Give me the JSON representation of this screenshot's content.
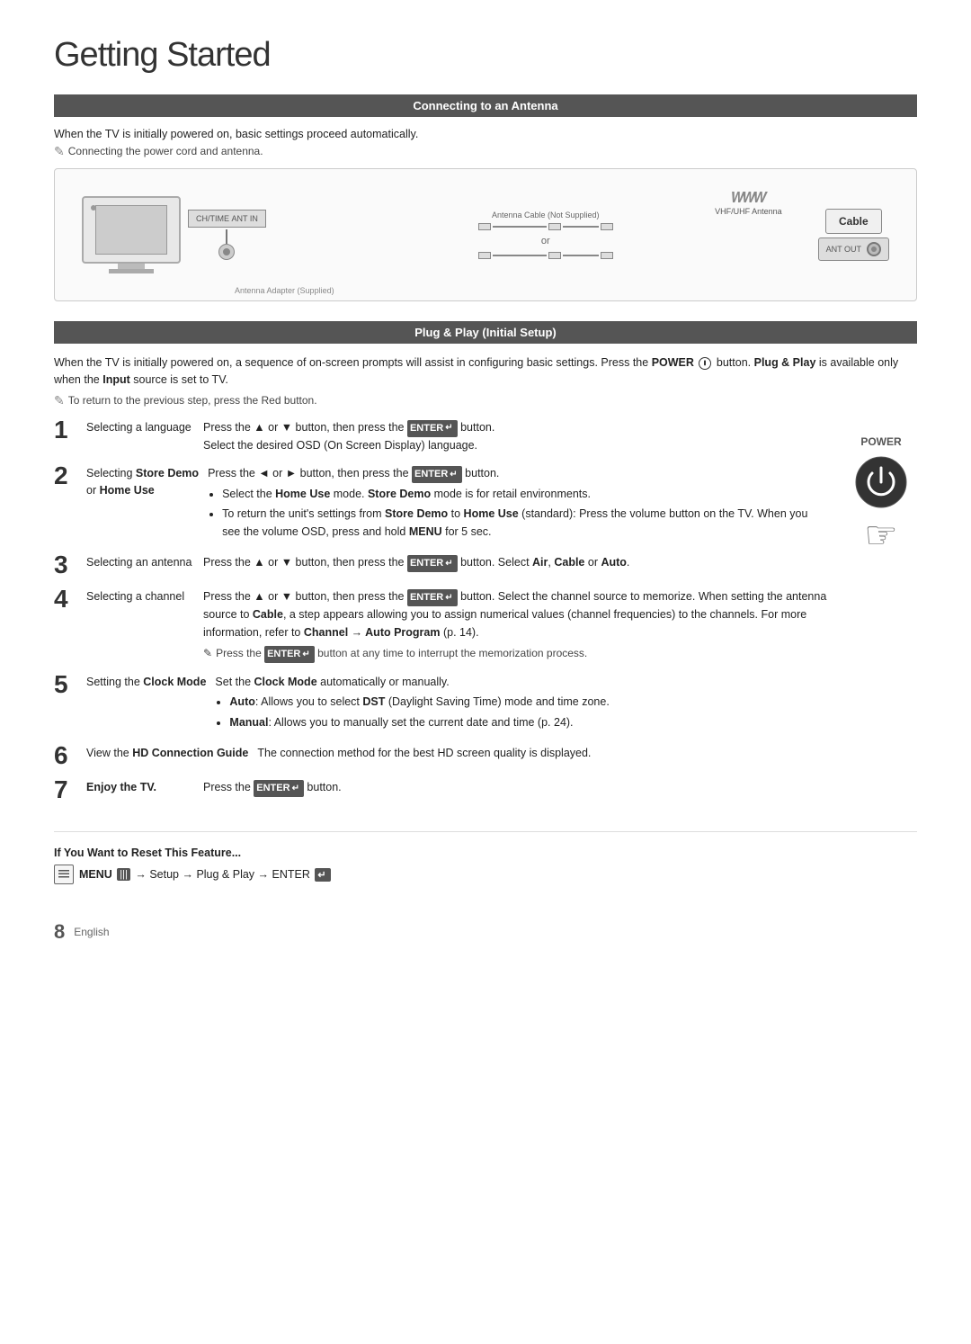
{
  "page": {
    "title": "Getting Started",
    "footer_number": "8",
    "footer_lang": "English"
  },
  "section1": {
    "header": "Connecting to an Antenna",
    "intro": "When the TV is initially powered on, basic settings proceed automatically.",
    "note": "Connecting the power cord and antenna.",
    "diagram": {
      "vhf_label": "VHF/UHF Antenna",
      "cable_label": "Cable",
      "ant_out_label": "ANT OUT",
      "cable_not_supplied": "Antenna Cable (Not Supplied)",
      "adapter_label": "Antenna Adapter (Supplied)",
      "or_text": "or"
    }
  },
  "section2": {
    "header": "Plug & Play (Initial Setup)",
    "intro1": "When the TV is initially powered on, a sequence of on-screen prompts will assist in configuring basic settings. Press the",
    "intro_power": "POWER",
    "intro2": "button.",
    "intro3": "Plug & Play",
    "intro4": "is available only when the",
    "intro5": "Input",
    "intro6": "source is set to TV.",
    "note": "To return to the previous step, press the Red button.",
    "power_label": "POWER",
    "steps": [
      {
        "number": "1",
        "label": "Selecting a language",
        "desc": "Press the ▲ or ▼ button, then press the ENTER button. Select the desired OSD (On Screen Display) language."
      },
      {
        "number": "2",
        "label": "Selecting Store Demo or Home Use",
        "desc_short": "Press the ◄ or ► button, then press the ENTER button.",
        "bullets": [
          "Select the Home Use mode. Store Demo mode is for retail environments.",
          "To return the unit's settings from Store Demo to Home Use (standard): Press the volume button on the TV. When you see the volume OSD, press and hold MENU for 5 sec."
        ]
      },
      {
        "number": "3",
        "label": "Selecting an antenna",
        "desc": "Press the ▲ or ▼ button, then press the ENTER button. Select Air, Cable or Auto."
      },
      {
        "number": "4",
        "label": "Selecting a channel",
        "desc": "Press the ▲ or ▼ button, then press the ENTER button. Select the channel source to memorize. When setting the antenna source to Cable, a step appears allowing you to assign numerical values (channel frequencies) to the channels. For more information, refer to Channel → Auto Program (p. 14).",
        "note_sub": "Press the ENTER button at any time to interrupt the memorization process."
      },
      {
        "number": "5",
        "label": "Setting the Clock Mode",
        "desc_short": "Set the Clock Mode automatically or manually.",
        "bullets": [
          "Auto: Allows you to select DST (Daylight Saving Time) mode and time zone.",
          "Manual: Allows you to manually set the current date and time (p. 24)."
        ]
      },
      {
        "number": "6",
        "label": "View the HD Connection Guide",
        "desc": "The connection method for the best HD screen quality is displayed."
      },
      {
        "number": "7",
        "label": "Enjoy the TV.",
        "desc": "Press the ENTER button."
      }
    ],
    "reset_heading": "If You Want to Reset This Feature...",
    "menu_cmd": "MENU",
    "menu_cmd2": "→ Setup → Plug & Play → ENTER"
  }
}
